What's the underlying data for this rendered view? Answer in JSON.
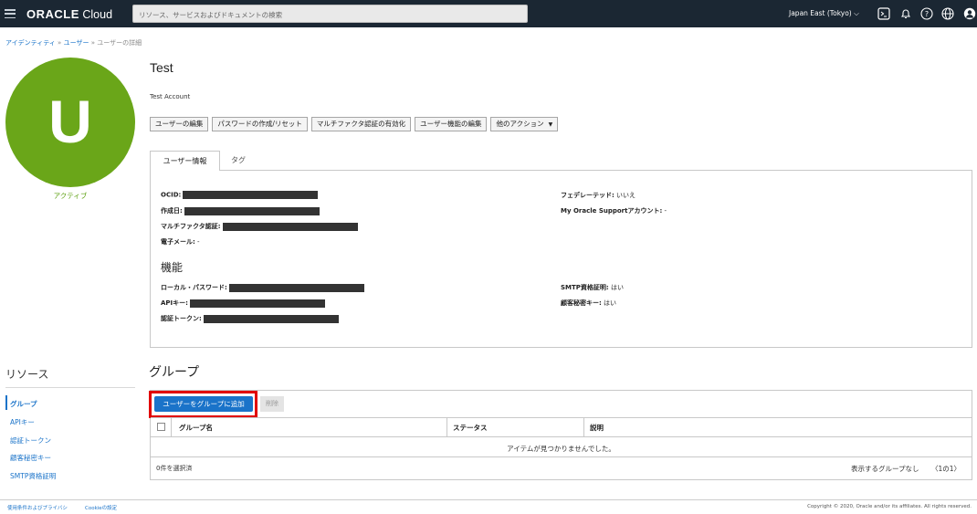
{
  "header": {
    "logo_bold": "ORACLE",
    "logo_light": " Cloud",
    "search_placeholder": "リソース、サービスおよびドキュメントの検索",
    "region": "Japan East (Tokyo)",
    "icons": [
      "terminal-icon",
      "bell-icon",
      "help-icon",
      "globe-icon",
      "user-icon"
    ]
  },
  "breadcrumb": {
    "items": [
      "アイデンティティ",
      "ユーザー",
      "ユーザーの詳細"
    ],
    "separator": "»"
  },
  "user": {
    "initial": "U",
    "status": "アクティブ",
    "name": "Test",
    "description": "Test Account",
    "avatar_color": "#6aa619"
  },
  "actions": {
    "edit": "ユーザーの編集",
    "password": "パスワードの作成/リセット",
    "mfa": "マルチファクタ認証の有効化",
    "capabilities": "ユーザー機能の編集",
    "more": "他のアクション"
  },
  "tabs": [
    "ユーザー情報",
    "タグ"
  ],
  "info": {
    "ocid_label": "OCID:",
    "created_label": "作成日:",
    "mfa_label": "マルチファクタ認証:",
    "email_label": "電子メール:",
    "email_value": "-",
    "federated_label": "フェデレーテッド:",
    "federated_value": "いいえ",
    "support_label": "My Oracle Supportアカウント:",
    "support_value": "-"
  },
  "capabilities": {
    "title": "機能",
    "local_password_label": "ローカル・パスワード:",
    "api_key_label": "APIキー:",
    "auth_token_label": "認証トークン:",
    "smtp_label": "SMTP資格証明:",
    "smtp_value": "はい",
    "customer_secret_label": "顧客秘密キー:",
    "customer_secret_value": "はい"
  },
  "resources": {
    "title": "リソース",
    "items": [
      "グループ",
      "APIキー",
      "認証トークン",
      "顧客秘密キー",
      "SMTP資格証明"
    ]
  },
  "groups": {
    "title": "グループ",
    "add_button": "ユーザーをグループに追加",
    "delete_button": "削除",
    "columns": [
      "グループ名",
      "ステータス",
      "説明"
    ],
    "empty_message": "アイテムが見つかりませんでした。",
    "selected": "0件を選択済",
    "showing": "表示するグループなし",
    "pagination": "1の1"
  },
  "footer": {
    "terms": "使用条件およびプライバシ",
    "cookie": "Cookieの設定",
    "copyright": "Copyright © 2020, Oracle and/or its affiliates. All rights reserved."
  }
}
